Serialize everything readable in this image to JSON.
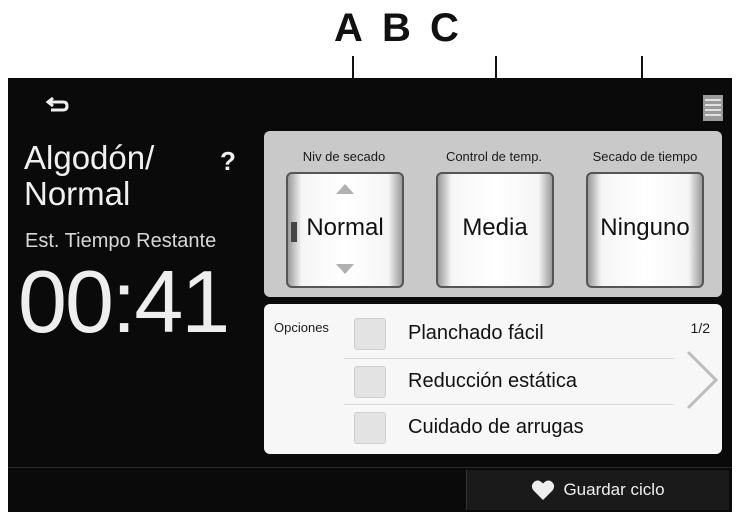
{
  "callouts": {
    "a": "A",
    "b": "B",
    "c": "C"
  },
  "header": {
    "back_icon": "back-arrow-icon",
    "menu_icon": "menu-icon"
  },
  "program": {
    "name_line1": "Algodón/",
    "name_line2": "Normal",
    "help": "?"
  },
  "timer": {
    "label": "Est. Tiempo Restante",
    "value": "00:41"
  },
  "settings": [
    {
      "label": "Niv de secado",
      "value": "Normal"
    },
    {
      "label": "Control de temp.",
      "value": "Media"
    },
    {
      "label": "Secado de tiempo",
      "value": "Ninguno"
    }
  ],
  "options": {
    "label": "Opciones",
    "page": "1/2",
    "items": [
      {
        "label": "Planchado fácil",
        "checked": false
      },
      {
        "label": "Reducción estática",
        "checked": false
      },
      {
        "label": "Cuidado de arrugas",
        "checked": false
      }
    ]
  },
  "footer": {
    "save_label": "Guardar ciclo",
    "save_icon": "heart-icon"
  },
  "colors": {
    "screen_bg": "#0a0a0a",
    "settings_panel": "#c9c9c9",
    "options_panel": "#f7f7f7"
  }
}
